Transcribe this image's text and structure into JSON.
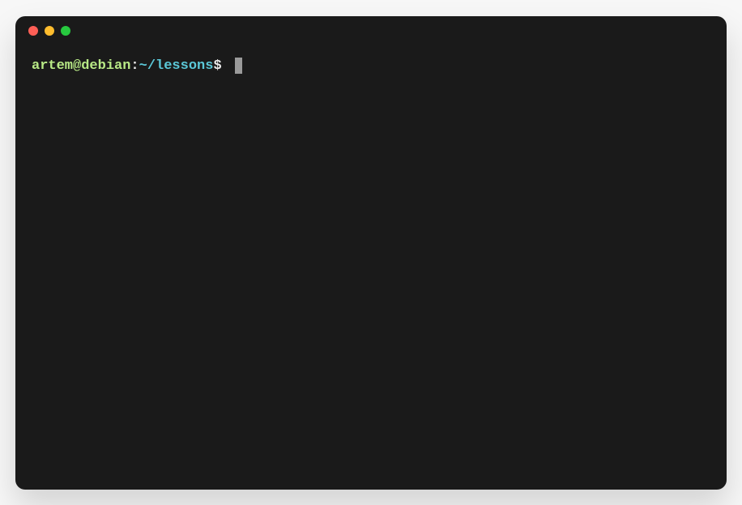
{
  "prompt": {
    "user_host": "artem@debian",
    "colon": ":",
    "path": "~/lessons",
    "dollar": "$ "
  },
  "colors": {
    "background": "#1a1a1a",
    "user_host": "#b8e986",
    "path": "#5bc8d8",
    "text": "#e8e8e8",
    "cursor": "#9a9a9a",
    "close": "#ff5f56",
    "minimize": "#ffbd2e",
    "maximize": "#27c93f"
  }
}
